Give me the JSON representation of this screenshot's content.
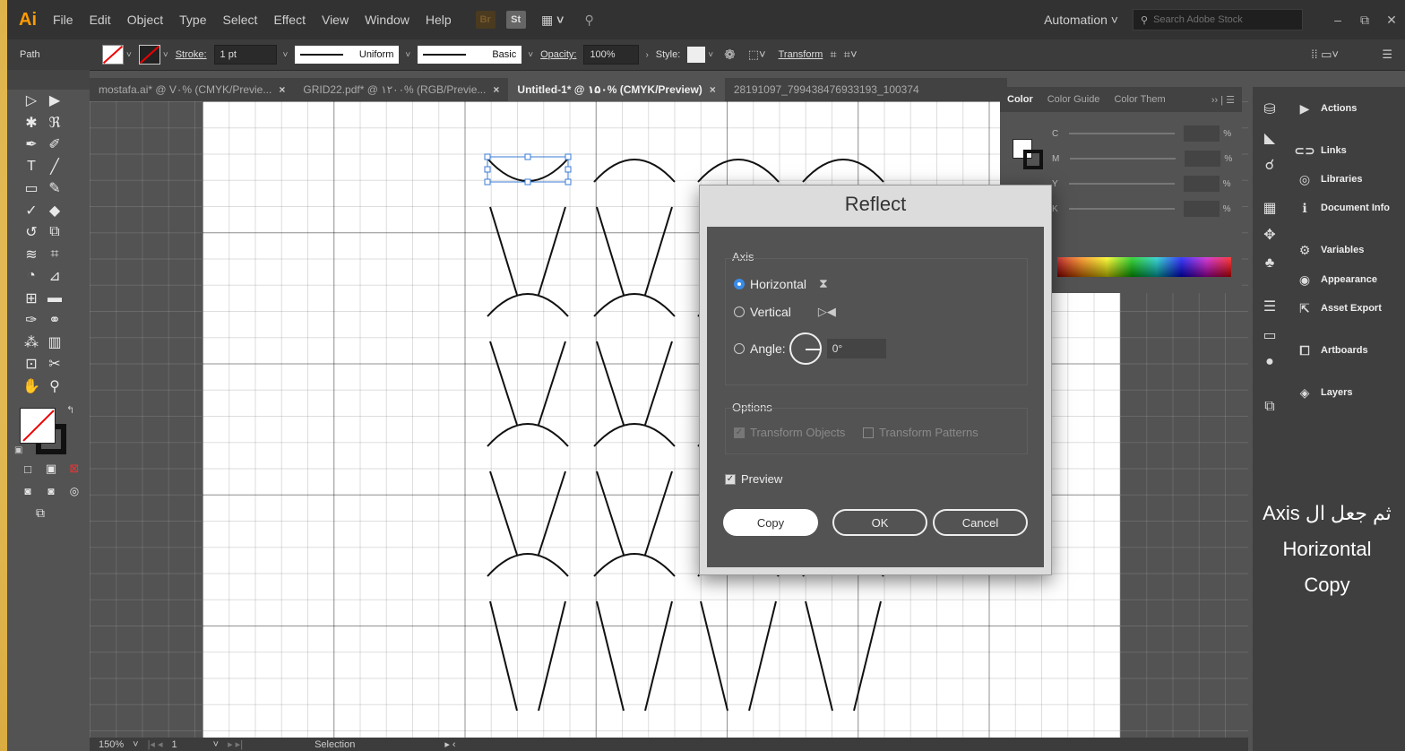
{
  "menubar": {
    "app_logo": "Ai",
    "items": [
      "File",
      "Edit",
      "Object",
      "Type",
      "Select",
      "Effect",
      "View",
      "Window",
      "Help"
    ],
    "mini_buttons": [
      "Br",
      "St"
    ],
    "workspace": "Automation",
    "stock_search_placeholder": "Search Adobe Stock",
    "window_controls": [
      "–",
      "⧉",
      "✕"
    ]
  },
  "controlbar": {
    "selection_type": "Path",
    "stroke_label": "Stroke:",
    "stroke_weight": "1 pt",
    "profile": "Uniform",
    "brush": "Basic",
    "opacity_label": "Opacity:",
    "opacity_value": "100%",
    "style_label": "Style:",
    "transform_label": "Transform"
  },
  "tabs": [
    {
      "label": "mostafa.ai* @ V۰% (CMYK/Previe...",
      "active": false
    },
    {
      "label": "GRID22.pdf* @ ۱۲۰۰% (RGB/Previe...",
      "active": false
    },
    {
      "label": "Untitled-1* @ ۱۵۰% (CMYK/Preview)",
      "active": true
    },
    {
      "label": "28191097_799438476933193_100374",
      "active": false
    }
  ],
  "color_panel": {
    "tabs": [
      "Color",
      "Color Guide",
      "Color Them"
    ],
    "channels": [
      "C",
      "M",
      "Y",
      "K"
    ],
    "unit": "%"
  },
  "dock_panels": [
    "Actions",
    "Links",
    "Libraries",
    "Document Info",
    "Variables",
    "Appearance",
    "Asset Export",
    "Artboards",
    "Layers"
  ],
  "dialog": {
    "title": "Reflect",
    "axis_label": "Axis",
    "horizontal_label": "Horizontal",
    "vertical_label": "Vertical",
    "angle_label": "Angle:",
    "angle_value": "0°",
    "selected_axis": "horizontal",
    "options_label": "Options",
    "transform_objects_label": "Transform Objects",
    "transform_patterns_label": "Transform Patterns",
    "preview_label": "Preview",
    "preview_checked": true,
    "copy_button": "Copy",
    "ok_button": "OK",
    "cancel_button": "Cancel"
  },
  "statusbar": {
    "zoom": "150%",
    "artboard_number": "1",
    "tool": "Selection"
  },
  "caption": {
    "line1": "ثم جعل ال Axis",
    "line2": "Horizontal",
    "line3": "Copy"
  },
  "colors": {
    "accent": "#3a8be8",
    "app_bg": "#535353",
    "menu_bg": "#323232",
    "ai_logo": "#ff9a00"
  }
}
